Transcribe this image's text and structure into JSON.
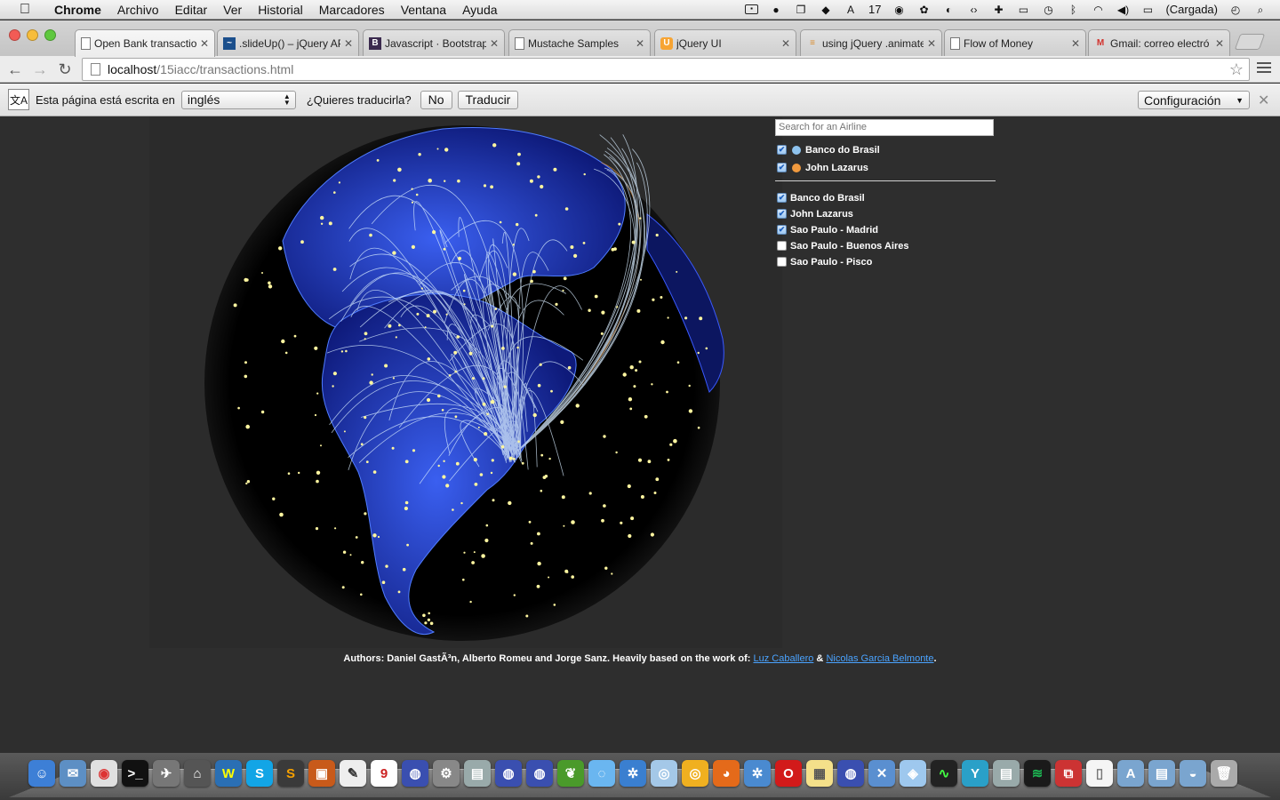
{
  "menubar": {
    "app": "Chrome",
    "items": [
      "Archivo",
      "Editar",
      "Ver",
      "Historial",
      "Marcadores",
      "Ventana",
      "Ayuda"
    ],
    "status": {
      "calendar_day": "17",
      "battery": "(Cargada)"
    }
  },
  "tabs": [
    {
      "title": "Open Bank transactio",
      "active": true,
      "icon": "page-icon"
    },
    {
      "title": ".slideUp() – jQuery AP",
      "active": false,
      "icon": "jquery-icon"
    },
    {
      "title": "Javascript · Bootstrap",
      "active": false,
      "icon": "bootstrap-icon"
    },
    {
      "title": "Mustache Samples",
      "active": false,
      "icon": "page-icon"
    },
    {
      "title": "jQuery UI",
      "active": false,
      "icon": "jquery-ui-icon"
    },
    {
      "title": "using jQuery .animate",
      "active": false,
      "icon": "stackoverflow-icon"
    },
    {
      "title": "Flow of Money",
      "active": false,
      "icon": "page-icon"
    },
    {
      "title": "Gmail: correo electró",
      "active": false,
      "icon": "gmail-icon"
    }
  ],
  "omnibox": {
    "host": "localhost",
    "path": "/15iacc/transactions.html"
  },
  "translate": {
    "prompt": "Esta página está escrita en",
    "language": "inglés",
    "question": "¿Quieres traducirla?",
    "no": "No",
    "translate": "Traducir",
    "settings": "Configuración"
  },
  "sidebar": {
    "search_placeholder": "Search for an Airline",
    "legend": [
      {
        "label": "Banco do Brasil",
        "color": "#8ec3ee",
        "checked": true
      },
      {
        "label": "John Lazarus",
        "color": "#f19a3e",
        "checked": true
      }
    ],
    "filters": [
      {
        "label": "Banco do Brasil",
        "checked": true
      },
      {
        "label": "John Lazarus",
        "checked": true
      },
      {
        "label": "Sao Paulo - Madrid",
        "checked": true
      },
      {
        "label": "Sao Paulo - Buenos Aires",
        "checked": false
      },
      {
        "label": "Sao Paulo - Pisco",
        "checked": false
      }
    ]
  },
  "credits": {
    "prefix": "Authors: Daniel GastÃ³n, Alberto Romeu and Jorge Sanz. Heavily based on the work of:",
    "link1": "Luz Caballero",
    "amp": "&",
    "link2": "Nicolas Garcia Belmonte",
    "suffix": "."
  },
  "colors": {
    "globe_land": "#1a2fa8",
    "city_dot": "#fff6a0",
    "arc": "#cfe8ff",
    "background": "#2e2e2e"
  }
}
